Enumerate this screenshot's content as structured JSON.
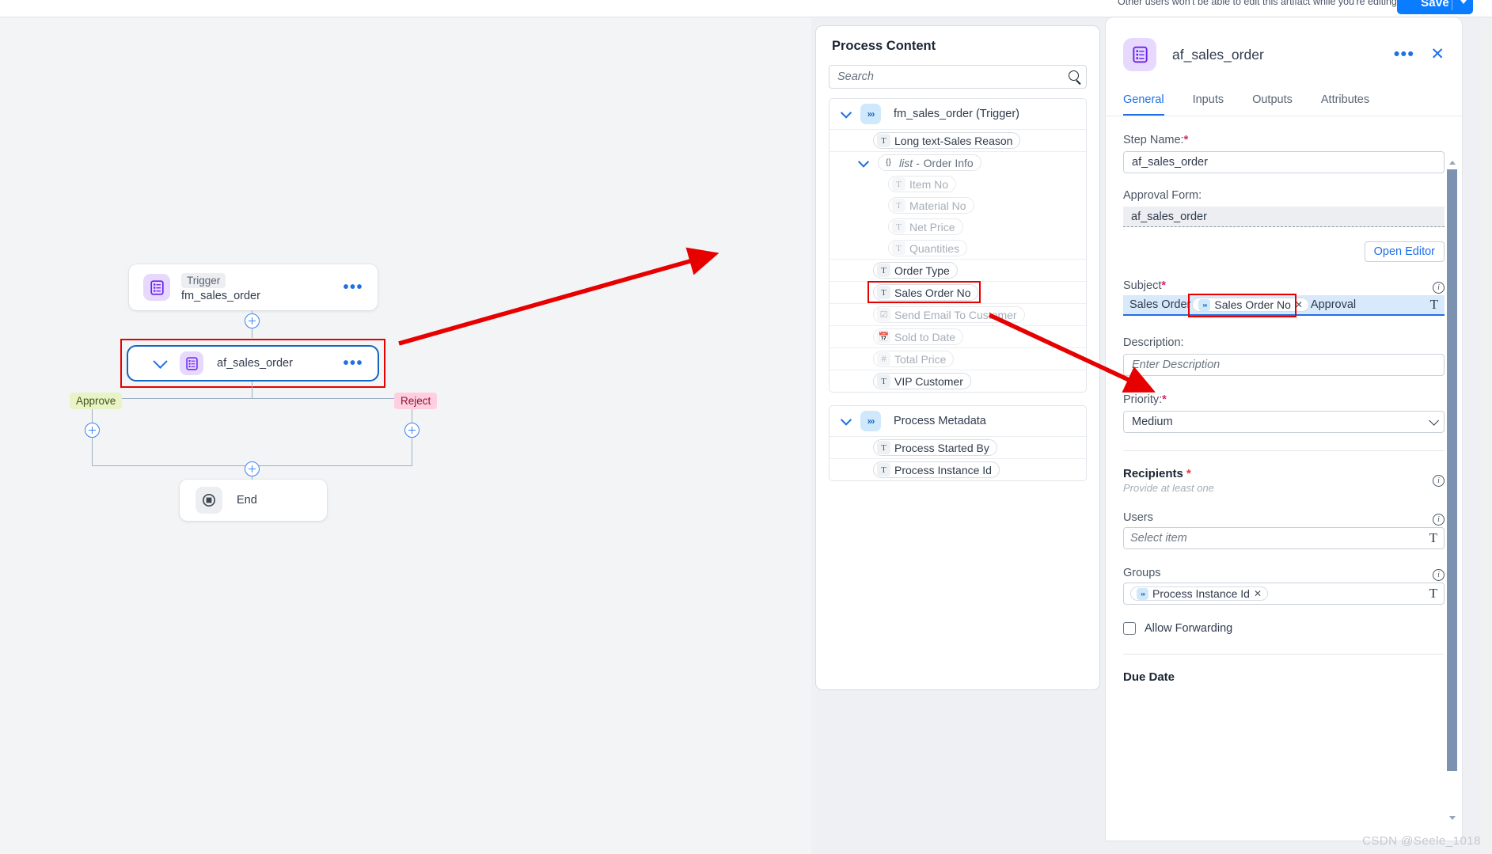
{
  "topbar": {
    "message": "Other users won't be able to edit this artifact while you're editing it.",
    "save_label": "Save"
  },
  "canvas": {
    "nodes": [
      {
        "kind": "trigger",
        "badge": "Trigger",
        "name": "fm_sales_order"
      },
      {
        "kind": "step",
        "name": "af_sales_order",
        "selected": true
      },
      {
        "kind": "end",
        "name": "End"
      }
    ],
    "branches": [
      {
        "label": "Approve",
        "bg": "#e8f3c8",
        "fg": "#3f5410"
      },
      {
        "label": "Reject",
        "bg": "#ffcfe0",
        "fg": "#8e1230"
      }
    ]
  },
  "process_content": {
    "title": "Process Content",
    "search_placeholder": "Search",
    "groups": [
      {
        "name": "fm_sales_order (Trigger)",
        "icon": "chevrons-right-icon",
        "items": [
          {
            "label": "Long text-Sales Reason",
            "type": "T",
            "dim": false,
            "indent": 0
          },
          {
            "label": "Order Info",
            "prefix": "list - ",
            "type": "{}",
            "dim": true,
            "indent": 1,
            "group": true
          },
          {
            "label": "Item No",
            "type": "T",
            "dim": true,
            "indent": 2
          },
          {
            "label": "Material No",
            "type": "T",
            "dim": true,
            "indent": 2
          },
          {
            "label": "Net Price",
            "type": "T",
            "dim": true,
            "indent": 2
          },
          {
            "label": "Quantities",
            "type": "T",
            "dim": true,
            "indent": 2
          },
          {
            "label": "Order Type",
            "type": "T",
            "dim": false,
            "indent": 0
          },
          {
            "label": "Sales Order No",
            "type": "T",
            "dim": false,
            "indent": 0,
            "highlighted": true
          },
          {
            "label": "Send Email To Customer",
            "type": "check",
            "dim": true,
            "indent": 0
          },
          {
            "label": "Sold to Date",
            "type": "cal",
            "dim": true,
            "indent": 0
          },
          {
            "label": "Total Price",
            "type": "#",
            "dim": true,
            "indent": 0
          },
          {
            "label": "VIP Customer",
            "type": "T",
            "dim": false,
            "indent": 0
          }
        ]
      },
      {
        "name": "Process Metadata",
        "icon": "chevrons-right-icon",
        "items": [
          {
            "label": "Process Started By",
            "type": "T",
            "dim": false,
            "indent": 0
          },
          {
            "label": "Process Instance Id",
            "type": "T",
            "dim": false,
            "indent": 0
          }
        ]
      }
    ]
  },
  "details": {
    "title": "af_sales_order",
    "tabs": [
      {
        "label": "General",
        "active": true
      },
      {
        "label": "Inputs",
        "active": false
      },
      {
        "label": "Outputs",
        "active": false
      },
      {
        "label": "Attributes",
        "active": false
      }
    ],
    "step_name_label": "Step Name:",
    "step_name_value": "af_sales_order",
    "approval_form_label": "Approval Form:",
    "approval_form_value": "af_sales_order",
    "open_editor_label": "Open Editor",
    "subject_label": "Subject",
    "subject_prefix": "Sales Order",
    "subject_token": "Sales Order No",
    "subject_suffix": "Approval",
    "description_label": "Description:",
    "description_placeholder": "Enter Description",
    "priority_label": "Priority:",
    "priority_value": "Medium",
    "recipients_title": "Recipients",
    "recipients_sub": "Provide at least one",
    "users_label": "Users",
    "users_placeholder": "Select item",
    "groups_label": "Groups",
    "groups_token": "Process Instance Id",
    "allow_forwarding_label": "Allow Forwarding",
    "due_date_label": "Due Date"
  },
  "watermark": "CSDN @Seele_1018",
  "colors": {
    "accent": "#1f6fe5",
    "selection": "#1464c0",
    "annotation": "#e60000",
    "purple_icon": "#e6d9fd",
    "canvas": "#f3f4f6"
  }
}
